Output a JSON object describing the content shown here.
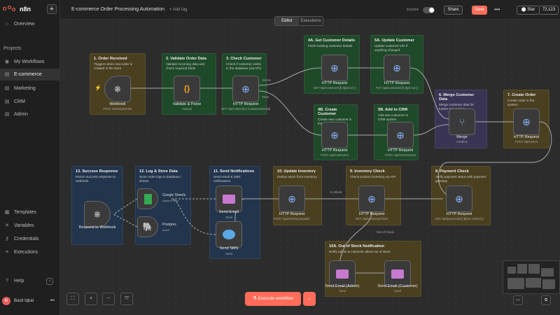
{
  "app": {
    "logo": "n8n"
  },
  "sidebar": {
    "top": [
      {
        "label": "Overview",
        "icon": "home-icon",
        "glyph": "⌂"
      }
    ],
    "section_title": "Projects",
    "projects": [
      {
        "label": "My Workflows",
        "icon": "user-icon",
        "glyph": "👤"
      },
      {
        "label": "E-commerce",
        "icon": "layers-icon",
        "glyph": "▤",
        "active": true
      },
      {
        "label": "Marketing",
        "icon": "layers-icon",
        "glyph": "▤"
      },
      {
        "label": "CRM",
        "icon": "layers-icon",
        "glyph": "▤"
      },
      {
        "label": "Admin",
        "icon": "layers-icon",
        "glyph": "▤"
      }
    ],
    "bottom": [
      {
        "label": "Templates",
        "icon": "template-icon",
        "glyph": "▦"
      },
      {
        "label": "Variables",
        "icon": "variables-icon",
        "glyph": "✕"
      },
      {
        "label": "Credentials",
        "icon": "key-icon",
        "glyph": "⚷"
      },
      {
        "label": "Executions",
        "icon": "list-icon",
        "glyph": "≡"
      }
    ],
    "help": {
      "label": "Help",
      "glyph": "?"
    },
    "user": {
      "initials": "BI",
      "name": "Basit Iqbal",
      "more": "•••"
    }
  },
  "topbar": {
    "title": "E-commerce Order Processing Automation",
    "add_tag": "+ Add tag",
    "status": "Inactive",
    "share": "Share",
    "save": "Save",
    "more": "•••",
    "github_star": "Star",
    "star_count": "72,123"
  },
  "tabs": [
    {
      "label": "Editor",
      "active": true
    },
    {
      "label": "Executions",
      "active": false
    }
  ],
  "notes": {
    "n1": {
      "title": "1. Order Received",
      "body": "Triggers when new order is created in the store"
    },
    "n2": {
      "title": "2. Validate Order Data",
      "body": "Validate incoming data and check required fields"
    },
    "n3": {
      "title": "3. Check Customer",
      "body": "Check if customer exists in the database (via API)"
    },
    "n4a": {
      "title": "4A. Get Customer Details",
      "body": "Fetch existing customer details"
    },
    "n5a": {
      "title": "5A. Update Customer",
      "body": "Update customer info if anything changed"
    },
    "n4b": {
      "title": "4B. Create Customer",
      "body": "Create new customer in the system"
    },
    "n5b": {
      "title": "5B. Add to CRM",
      "body": "Add new customer to CRM system"
    },
    "n6": {
      "title": "6. Merge Customer Data",
      "body": "Merge customer data for further processing"
    },
    "n7": {
      "title": "7. Create Order",
      "body": "Create order in the system"
    },
    "n8": {
      "title": "8. Payment Check",
      "body": "Verify payment status with payment gateway"
    },
    "n9": {
      "title": "9. Inventory Check",
      "body": "Check product inventory via API"
    },
    "n10": {
      "title": "10. Update Inventory",
      "body": "Deduct stock from inventory"
    },
    "n10a": {
      "title": "10A. Out of Stock Notification",
      "body": "Notify admin & customer about out of stock"
    },
    "n11": {
      "title": "11. Send Notifications",
      "body": "Send email & SMS notifications"
    },
    "n12": {
      "title": "12. Log & Store Data",
      "body": "Store order logs in database / sheets"
    },
    "n13": {
      "title": "13. Success Response",
      "body": "Return success response to webhook"
    }
  },
  "nodes": {
    "webhook": {
      "label": "Webhook",
      "sub": "POST /webhook/order"
    },
    "validate": {
      "label": "Validate & Parse",
      "sub": "manual"
    },
    "check_customer": {
      "label": "HTTP Request",
      "sub": "GET /api/customers /customer/{email}"
    },
    "get_customer": {
      "label": "HTTP Request",
      "sub": "GET /api/customers/{{ $json.id }}"
    },
    "update_customer": {
      "label": "HTTP Request",
      "sub": "PUT /api/customers/{{ $json.id }}"
    },
    "create_customer": {
      "label": "HTTP Request",
      "sub": "POST /api/customers"
    },
    "add_crm": {
      "label": "HTTP Request",
      "sub": "POST /api/crm/contacts"
    },
    "merge": {
      "label": "Merge",
      "sub": "combine"
    },
    "create_order": {
      "label": "HTTP Request",
      "sub": "POST /api/orders"
    },
    "payment": {
      "label": "HTTP Request",
      "sub": "GET /api/payments/{{ $json.orderId }}"
    },
    "inventory": {
      "label": "HTTP Request",
      "sub": "GET /api/inventory/check"
    },
    "update_inventory": {
      "label": "HTTP Request",
      "sub": "POST /api/inventory/update"
    },
    "email_admin": {
      "label": "Send Email (Admin)",
      "sub": "Send"
    },
    "email_customer": {
      "label": "Send Email (Customer)",
      "sub": "Send"
    },
    "send_email": {
      "label": "Send Email",
      "sub": "Send"
    },
    "send_sms": {
      "label": "Send SMS",
      "sub": "Send"
    },
    "sheets": {
      "label": "Google Sheets",
      "sub": "Append Row"
    },
    "postgres": {
      "label": "Postgres",
      "sub": "Insert"
    },
    "respond": {
      "label": "Respond to Webhook",
      "sub": ""
    }
  },
  "conn_labels": {
    "exists": "Exists",
    "new": "New",
    "in_stock": "In Stock",
    "out_of_stock": "Out of Stock"
  },
  "canvas_controls": {
    "fit": "⛶",
    "zoom_in": "+",
    "zoom_out": "−",
    "tidy": "⤧"
  },
  "execute": {
    "label": "Execute workflow",
    "icon": "flask-icon",
    "dropdown": "⌄"
  },
  "minimap_buttons": {
    "left": "▭",
    "right": "⧉"
  }
}
